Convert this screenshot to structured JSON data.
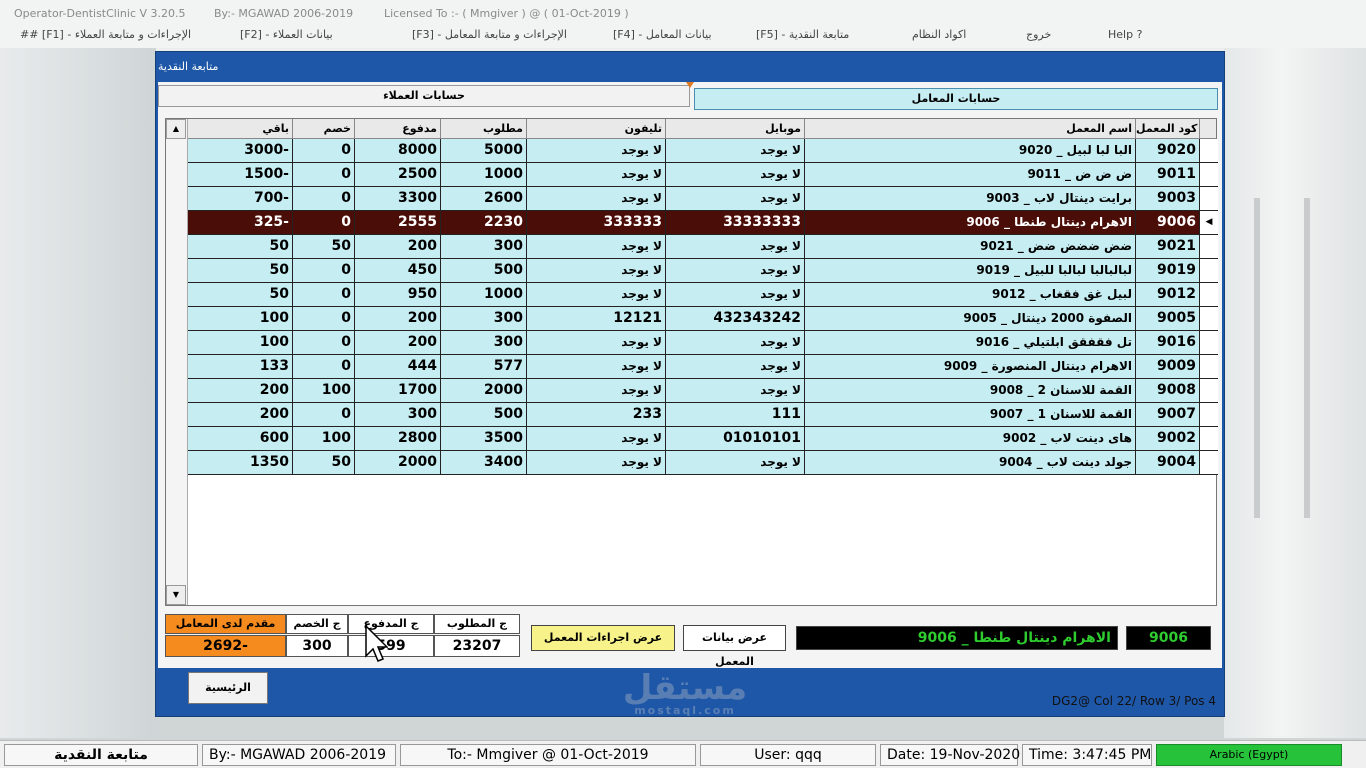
{
  "titlebar": {
    "app": "Operator-DentistClinic V 3.20.5",
    "by": "By:- MGAWAD 2006-2019",
    "licensed": "Licensed To :- ( Mmgiver ) @ ( 01-Oct-2019 )"
  },
  "menu": [
    {
      "label": "## [F1] - الإجراءات و متابعة العملاء"
    },
    {
      "label": "[F2] - بيانات العملاء"
    },
    {
      "label": "[F3] - الإجراءات و متابعة المعامل"
    },
    {
      "label": "[F4] - بيانات المعامل"
    },
    {
      "label": "[F5] - متابعة النقدية"
    },
    {
      "label": "اكواد النظام"
    },
    {
      "label": "خروج"
    },
    {
      "label": "Help ?"
    }
  ],
  "window": {
    "title": "متابعة النقدية",
    "tabs": [
      {
        "label": "حسابات العملاء",
        "active": false
      },
      {
        "label": "حسابات المعامل",
        "active": true
      }
    ]
  },
  "grid": {
    "columns": [
      "كود المعمل",
      "اسم المعمل",
      "موبايل",
      "تليفون",
      "مطلوب",
      "مدفوع",
      "خصم",
      "باقي"
    ],
    "rows": [
      {
        "code": "9020",
        "name": "البا لبا لبيل _ 9020",
        "mobile": "لا يوجد",
        "phone": "لا يوجد",
        "required": "5000",
        "paid": "8000",
        "discount": "0",
        "remaining": "3000-"
      },
      {
        "code": "9011",
        "name": "ض ض ض _ 9011",
        "mobile": "لا يوجد",
        "phone": "لا يوجد",
        "required": "1000",
        "paid": "2500",
        "discount": "0",
        "remaining": "1500-"
      },
      {
        "code": "9003",
        "name": "برايت دينتال لاب _ 9003",
        "mobile": "لا يوجد",
        "phone": "لا يوجد",
        "required": "2600",
        "paid": "3300",
        "discount": "0",
        "remaining": "700-"
      },
      {
        "code": "9006",
        "name": "الاهرام دينتال طنطا _ 9006",
        "mobile": "33333333",
        "phone": "333333",
        "required": "2230",
        "paid": "2555",
        "discount": "0",
        "remaining": "325-",
        "selected": true
      },
      {
        "code": "9021",
        "name": "ضض ضضض ضض _ 9021",
        "mobile": "لا يوجد",
        "phone": "لا يوجد",
        "required": "300",
        "paid": "200",
        "discount": "50",
        "remaining": "50"
      },
      {
        "code": "9019",
        "name": "لبالبالبا لبالبا للبيل _ 9019",
        "mobile": "لا يوجد",
        "phone": "لا يوجد",
        "required": "500",
        "paid": "450",
        "discount": "0",
        "remaining": "50"
      },
      {
        "code": "9012",
        "name": "لبيل غق فقغاب _ 9012",
        "mobile": "لا يوجد",
        "phone": "لا يوجد",
        "required": "1000",
        "paid": "950",
        "discount": "0",
        "remaining": "50"
      },
      {
        "code": "9005",
        "name": "الصفوة 2000 دينتال _ 9005",
        "mobile": "432343242",
        "phone": "12121",
        "required": "300",
        "paid": "200",
        "discount": "0",
        "remaining": "100"
      },
      {
        "code": "9016",
        "name": "تل فقفقق ابلتيلي _ 9016",
        "mobile": "لا يوجد",
        "phone": "لا يوجد",
        "required": "300",
        "paid": "200",
        "discount": "0",
        "remaining": "100"
      },
      {
        "code": "9009",
        "name": "الاهرام دينتال المنصورة _ 9009",
        "mobile": "لا يوجد",
        "phone": "لا يوجد",
        "required": "577",
        "paid": "444",
        "discount": "0",
        "remaining": "133"
      },
      {
        "code": "9008",
        "name": "القمة للاسنان 2 _ 9008",
        "mobile": "لا يوجد",
        "phone": "لا يوجد",
        "required": "2000",
        "paid": "1700",
        "discount": "100",
        "remaining": "200"
      },
      {
        "code": "9007",
        "name": "القمة للاسنان 1 _ 9007",
        "mobile": "111",
        "phone": "233",
        "required": "500",
        "paid": "300",
        "discount": "0",
        "remaining": "200"
      },
      {
        "code": "9002",
        "name": "هاى دينت لاب _ 9002",
        "mobile": "01010101",
        "phone": "لا يوجد",
        "required": "3500",
        "paid": "2800",
        "discount": "100",
        "remaining": "600"
      },
      {
        "code": "9004",
        "name": "جولد دينت لاب _ 9004",
        "mobile": "لا يوجد",
        "phone": "لا يوجد",
        "required": "3400",
        "paid": "2000",
        "discount": "50",
        "remaining": "1350"
      }
    ]
  },
  "totals": {
    "required_label": "ج المطلوب",
    "required_value": "23207",
    "paid_label": "ج المدفوع",
    "paid_value": "599",
    "discount_label": "ج الخصم",
    "discount_value": "300",
    "advance_label": "مقدم لدى المعامل",
    "advance_value": "2692-"
  },
  "buttons": {
    "show_procedures": "عرض اجراءات المعمل",
    "show_lab_data": "عرض بيانات المعمل",
    "home": "الرئيسية"
  },
  "selected_lab": {
    "name": "الاهرام دينتال طنطا _ 9006",
    "code": "9006"
  },
  "pos_info": "DG2@ Col 22/ Row 3/ Pos 4",
  "statusbar": {
    "page": "متابعة النقدية",
    "by": "By:- MGAWAD 2006-2019",
    "to": "To:- Mmgiver @ 01-Oct-2019",
    "user": "User: qqq",
    "date": "Date: 19-Nov-2020",
    "time": "Time: 3:47:45 PM",
    "lang": "Arabic (Egypt)"
  },
  "watermark": {
    "main": "مستقل",
    "sub": "mostaql.com"
  },
  "colors": {
    "window_blue": "#1e57a8",
    "row_cyan": "#c6eef2",
    "selected_row": "#4a0d08",
    "accent_orange": "#f58a1f",
    "button_yellow": "#f7f28a",
    "status_green": "#26c33a"
  }
}
